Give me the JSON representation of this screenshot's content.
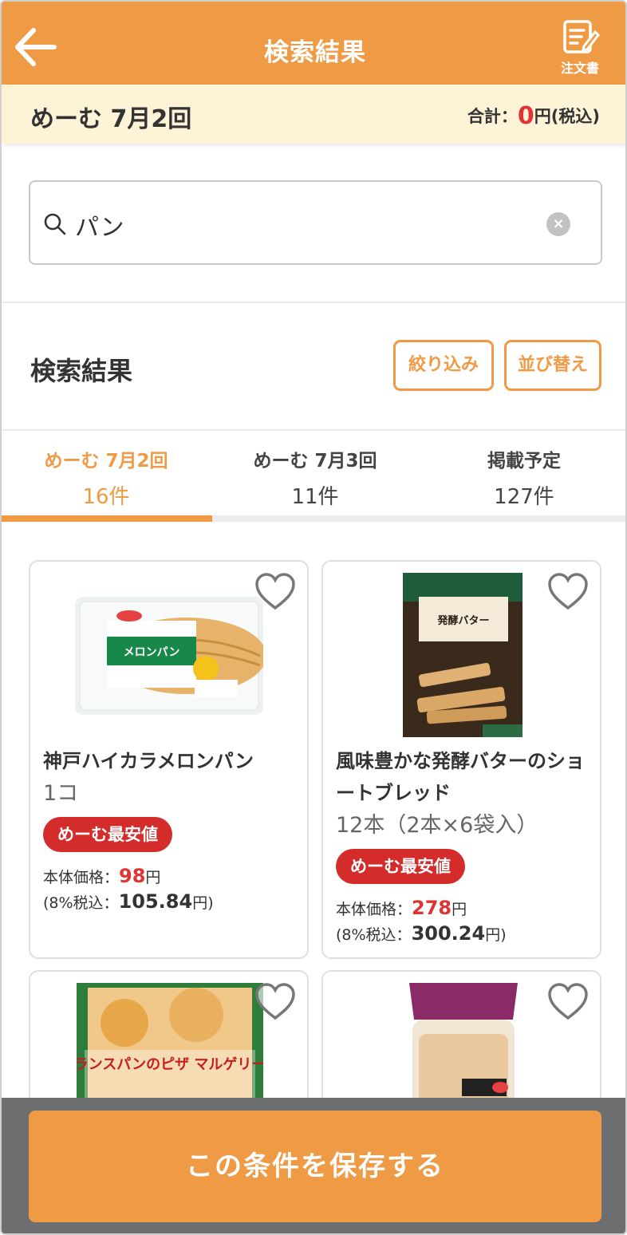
{
  "header": {
    "title": "検索結果",
    "order_label": "注文書"
  },
  "summary": {
    "title": "めーむ 7月2回",
    "total_label": "合計：",
    "total_amount": "0",
    "total_suffix": "円(税込)"
  },
  "search": {
    "query": "パン"
  },
  "results": {
    "title": "検索結果",
    "filter_label": "絞り込み",
    "sort_label": "並び替え"
  },
  "tabs": [
    {
      "name": "めーむ 7月2回",
      "count": "16件",
      "active": true
    },
    {
      "name": "めーむ 7月3回",
      "count": "11件",
      "active": false
    },
    {
      "name": "掲載予定",
      "count": "127件",
      "active": false
    }
  ],
  "products": [
    {
      "name": "神戸ハイカラメロンパン",
      "qty": "1コ",
      "badge": "めーむ最安値",
      "price_label": "本体価格：",
      "price": "98",
      "price_suffix": "円",
      "tax_prefix": "(8%税込：",
      "tax_price": "105.84",
      "tax_suffix": "円)"
    },
    {
      "name": "風味豊かな発酵バターのショートブレッド",
      "qty": "12本（2本×6袋入）",
      "badge": "めーむ最安値",
      "price_label": "本体価格：",
      "price": "278",
      "price_suffix": "円",
      "tax_prefix": "(8%税込：",
      "tax_price": "300.24",
      "tax_suffix": "円)"
    },
    {
      "name": "",
      "image_text": "フランスパンのピザ マルゲリータ"
    },
    {
      "name": ""
    }
  ],
  "bottom": {
    "save_label": "この条件を保存する"
  },
  "colors": {
    "accent": "#ef9a45",
    "price_red": "#e03434",
    "badge_red": "#d42b2b",
    "summary_bg": "#fdf3d6"
  }
}
